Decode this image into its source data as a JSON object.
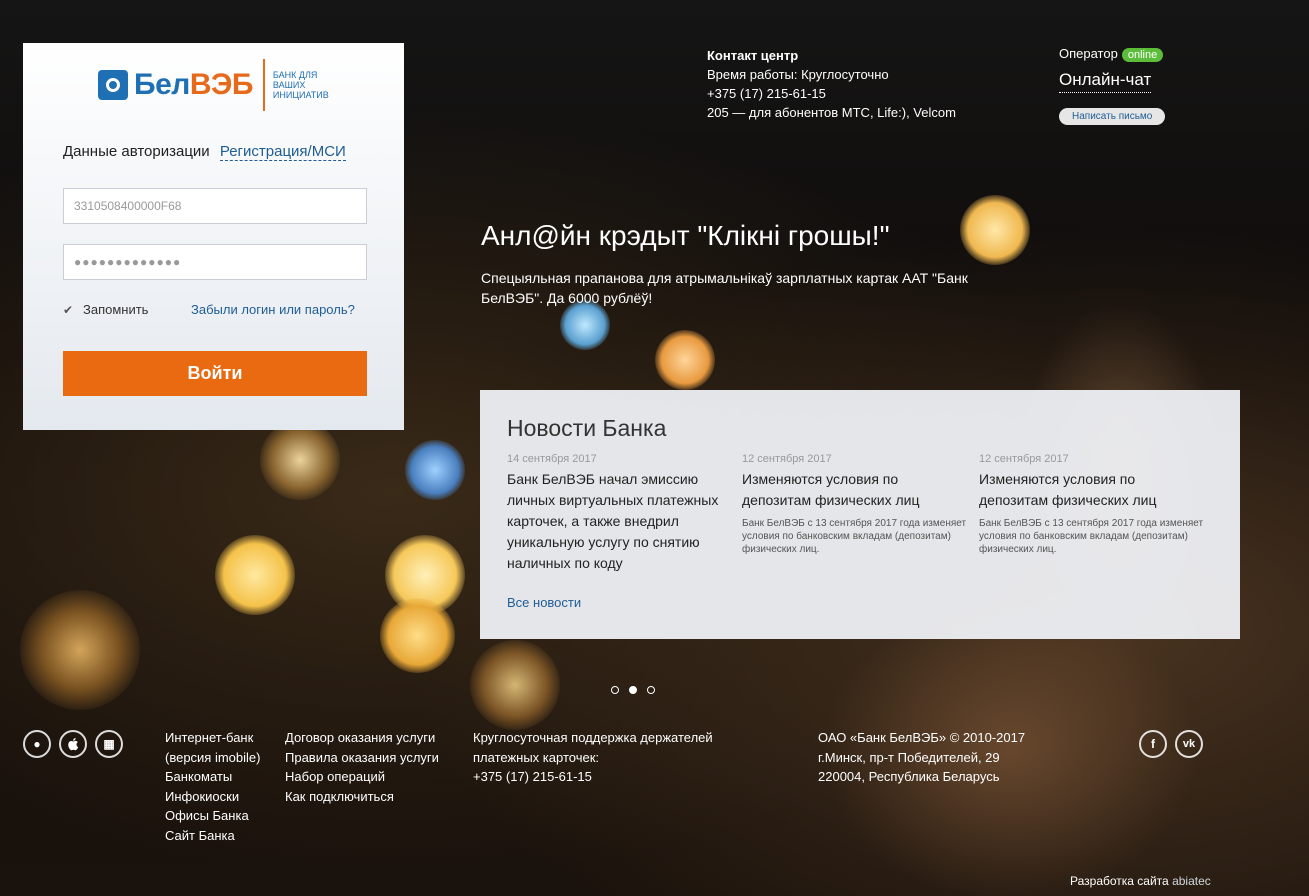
{
  "brand": {
    "logo_name_a": "Бел",
    "logo_name_b": "ВЭБ",
    "logo_tag": "Банк для ваших инициатив",
    "accent_color": "#ea6a12",
    "brand_blue": "#1f6fb5"
  },
  "login": {
    "tab_auth": "Данные авторизации",
    "tab_register": "Регистрация/МСИ",
    "login_value": "3310508400000F68",
    "password_value": "●●●●●●●●●●●●●",
    "remember_label": "Запомнить",
    "forgot_link": "Забыли логин или пароль?",
    "submit_label": "Войти"
  },
  "contact": {
    "title": "Контакт центр",
    "hours": "Время работы: Круглосуточно",
    "phone": "+375 (17) 215-61-15",
    "short_number": "205 — для абонентов МТС, Life:), Velcom"
  },
  "operator": {
    "label": "Оператор",
    "status": "online",
    "chat_link": "Онлайн-чат",
    "write_button": "Написать письмо"
  },
  "promo": {
    "title": "Анл@йн крэдыт \"Клікні грошы!\"",
    "text": "Спецыяльная прапанова для атрымальнікаў зарплатных картак ААТ \"Банк БелВЭБ\". Да 6000 рублёў!"
  },
  "news": {
    "title": "Новости Банка",
    "items": [
      {
        "date": "14 сентября 2017",
        "headline": "Банк БелВЭБ начал эмиссию личных виртуальных платежных карточек, а также внедрил уникальную услугу по снятию наличных по коду",
        "body": ""
      },
      {
        "date": "12 сентября 2017",
        "headline": "Изменяются условия по депозитам физических лиц",
        "body": "Банк БелВЭБ с 13 сентября 2017 года изменяет условия по банковским вкладам (депозитам) физических лиц."
      },
      {
        "date": "12 сентября 2017",
        "headline": "Изменяются условия по депозитам физических лиц",
        "body": "Банк БелВЭБ с 13 сентября 2017 года изменяет условия по банковским вкладам (депозитам) физических лиц."
      }
    ],
    "all_link": "Все новости"
  },
  "slider": {
    "count": 3,
    "active": 1
  },
  "footer": {
    "apps": [
      {
        "icon": "android-icon",
        "glyph": "●"
      },
      {
        "icon": "apple-icon",
        "glyph": ""
      },
      {
        "icon": "windows-icon",
        "glyph": "▦"
      }
    ],
    "col1": [
      "Интернет-банк",
      "(версия imobile)",
      "Банкоматы",
      "Инфокиоски",
      "Офисы Банка",
      "Сайт Банка"
    ],
    "col2": [
      "Договор оказания услуги",
      "Правила оказания услуги",
      "Набор операций",
      "Как подключиться"
    ],
    "col3": [
      "Круглосуточная поддержка держателей",
      "платежных карточек:",
      "+375 (17) 215-61-15"
    ],
    "legal": [
      "ОАО «Банк БелВЭБ» © 2010-2017",
      "г.Минск, пр-т Победителей, 29",
      "220004, Республика Беларусь"
    ],
    "social": [
      {
        "icon": "facebook-icon",
        "glyph": "f"
      },
      {
        "icon": "vk-icon",
        "glyph": "vk"
      }
    ],
    "dev_prefix": "Разработка сайта",
    "dev_name": "abiatec"
  }
}
